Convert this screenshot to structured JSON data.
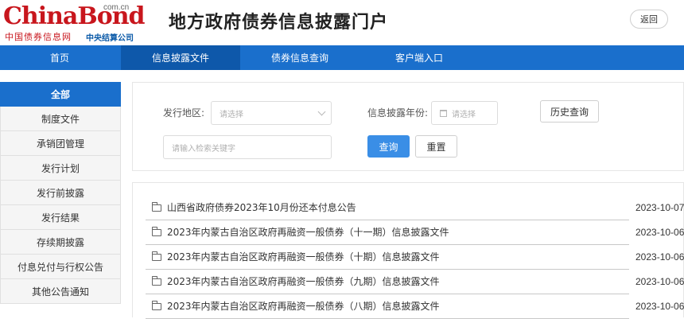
{
  "header": {
    "logo_text_main": "ChinaBond",
    "logo_text_com": "com.cn",
    "logo_text_cn": "中国债券信息网",
    "logo_text_org": "中央结算公司",
    "site_title": "地方政府债券信息披露门户",
    "back_label": "返回"
  },
  "nav": {
    "items": [
      {
        "label": "首页"
      },
      {
        "label": "信息披露文件"
      },
      {
        "label": "债券信息查询"
      },
      {
        "label": "客户端入口"
      }
    ],
    "active_index": 1
  },
  "sidebar": {
    "items": [
      {
        "label": "全部"
      },
      {
        "label": "制度文件"
      },
      {
        "label": "承销团管理"
      },
      {
        "label": "发行计划"
      },
      {
        "label": "发行前披露"
      },
      {
        "label": "发行结果"
      },
      {
        "label": "存续期披露"
      },
      {
        "label": "付息兑付与行权公告"
      },
      {
        "label": "其他公告通知"
      }
    ],
    "active_index": 0
  },
  "search": {
    "region_label": "发行地区:",
    "region_placeholder": "请选择",
    "year_label": "信息披露年份:",
    "year_placeholder": "请选择",
    "history_button": "历史查询",
    "keyword_placeholder": "请输入检索关键字",
    "query_button": "查询",
    "reset_button": "重置"
  },
  "list": {
    "items": [
      {
        "title": "山西省政府债券2023年10月份还本付息公告",
        "date": "2023-10-07"
      },
      {
        "title": "2023年内蒙古自治区政府再融资一般债券（十一期）信息披露文件",
        "date": "2023-10-06"
      },
      {
        "title": "2023年内蒙古自治区政府再融资一般债券（十期）信息披露文件",
        "date": "2023-10-06"
      },
      {
        "title": "2023年内蒙古自治区政府再融资一般债券（九期）信息披露文件",
        "date": "2023-10-06"
      },
      {
        "title": "2023年内蒙古自治区政府再融资一般债券（八期）信息披露文件",
        "date": "2023-10-06"
      }
    ]
  },
  "colors": {
    "nav_bg": "#1a6fcc",
    "nav_active": "#0e58aa",
    "logo_red": "#c8161d",
    "primary_button": "#3a8ee6"
  }
}
